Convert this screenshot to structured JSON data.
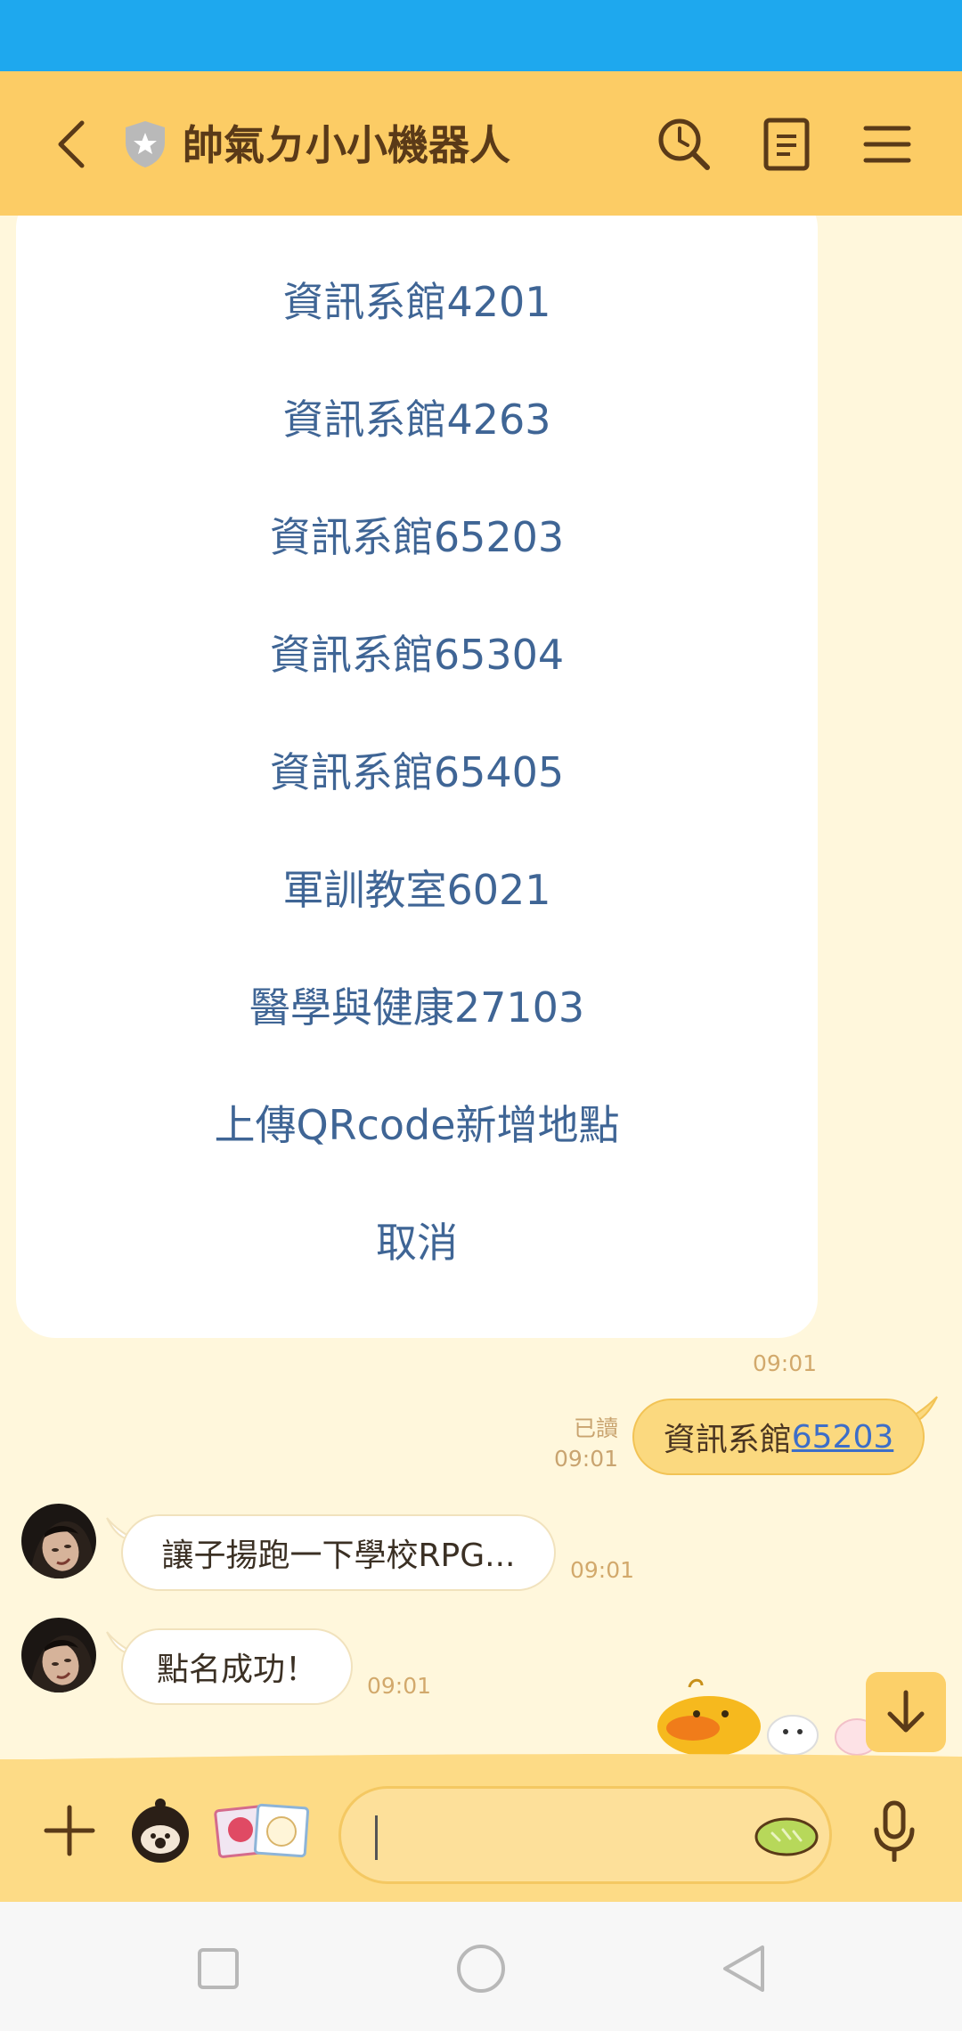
{
  "header": {
    "title": "帥氣ㄉ小小機器人"
  },
  "menu": {
    "items": [
      "資訊系館4201",
      "資訊系館4263",
      "資訊系館65203",
      "資訊系館65304",
      "資訊系館65405",
      "軍訓教室6021",
      "醫學與健康27103",
      "上傳QRcode新增地點",
      "取消"
    ],
    "time": "09:01"
  },
  "messages": {
    "outgoing": {
      "prefix": "資訊系館",
      "link": "65203",
      "read_label": "已讀",
      "time": "09:01"
    },
    "incoming": [
      {
        "text": "讓子揚跑一下學校RPG...",
        "time": "09:01"
      },
      {
        "text": "點名成功！",
        "time": "09:01"
      }
    ]
  },
  "colors": {
    "status_bar": "#1ea8ee",
    "header": "#fccc65",
    "background": "#fff7dc",
    "menu_text": "#3f6595",
    "outgoing_bubble": "#fbd97f",
    "link": "#3d6ec8"
  },
  "icons": {
    "header": [
      "back-arrow-icon",
      "shield-icon",
      "search-history-icon",
      "notes-icon",
      "menu-icon"
    ],
    "input_bar": [
      "plus-icon",
      "sticker-icon",
      "photo-icon",
      "emoji-icon",
      "microphone-icon"
    ],
    "nav": [
      "recents-square-icon",
      "home-circle-icon",
      "back-triangle-icon"
    ]
  }
}
